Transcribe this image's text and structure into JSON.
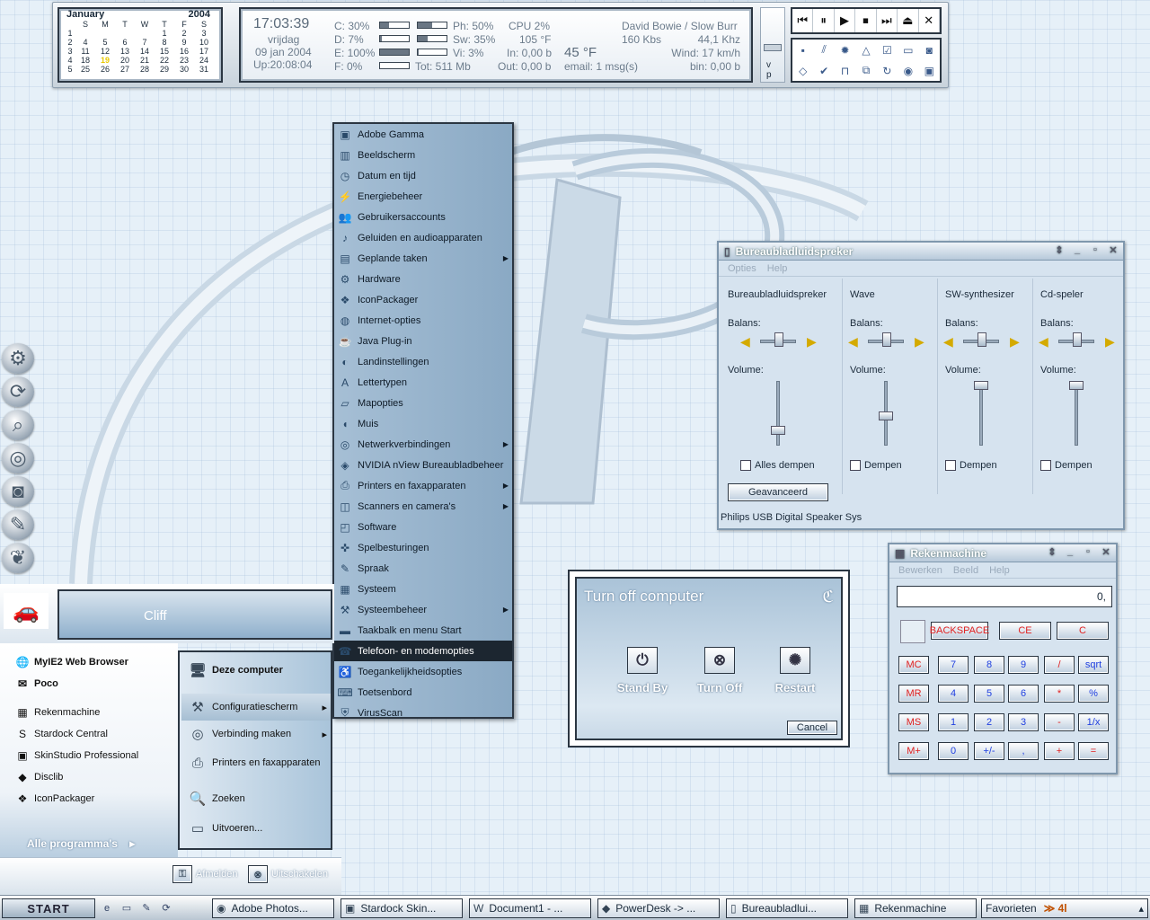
{
  "calendar": {
    "month": "January",
    "year": "2004",
    "weekdays": [
      "S",
      "M",
      "T",
      "W",
      "T",
      "F",
      "S"
    ],
    "weeks": [
      [
        "1",
        "",
        "",
        "",
        "",
        "1",
        "2",
        "3"
      ],
      [
        "2",
        "4",
        "5",
        "6",
        "7",
        "8",
        "9",
        "10"
      ],
      [
        "3",
        "11",
        "12",
        "13",
        "14",
        "15",
        "16",
        "17"
      ],
      [
        "4",
        "18",
        "19",
        "20",
        "21",
        "22",
        "23",
        "24"
      ],
      [
        "5",
        "25",
        "26",
        "27",
        "28",
        "29",
        "30",
        "31"
      ]
    ],
    "today": "19"
  },
  "sysinfo": {
    "time": "17:03:39",
    "day": "vrijdag",
    "date": "09 jan 2004",
    "uptime": "Up:20:08:04",
    "drive_c": "C: 30%",
    "drive_d": "D: 7%",
    "drive_e": "E: 100%",
    "drive_f": "F: 0%",
    "tot": "Tot: 511 Mb",
    "ph": "Ph: 50%",
    "sw": "Sw: 35%",
    "vi": "Vi: 3%",
    "cpu": "CPU 2%",
    "temp_f": "105 °F",
    "in": "In: 0,00 b",
    "out": "Out: 0,00 b",
    "weather": "45 °F",
    "email": "email: 1 msg(s)",
    "track": "David Bowie / Slow Burr",
    "kbps": "160 Kbs",
    "khz": "44,1 Khz",
    "wind": "Wind: 17 km/h",
    "bin": "bin: 0,00 b",
    "bars": {
      "c": 0.3,
      "d": 0.07,
      "e": 1.0,
      "f": 0.0,
      "ph": 0.5,
      "sw": 0.35,
      "vi": 0.03
    },
    "vol_labels": "v p"
  },
  "media": {
    "buttons": [
      "⏮",
      "⏸",
      "▶",
      "⏹",
      "⏭",
      "⏏",
      "✕"
    ],
    "icons": [
      "▪",
      "⫽",
      "✹",
      "△",
      "☑",
      "▭",
      "◙",
      "◇",
      "✔",
      "⊓",
      "⧉",
      "↻",
      "◉",
      "▣"
    ]
  },
  "dock": {
    "icons": [
      "control-panel-icon",
      "sync-icon",
      "search-icon",
      "disc-icon",
      "camera-icon",
      "paint-icon",
      "skin-icon"
    ]
  },
  "start_menu": {
    "user": "Cliff",
    "all_programs": "Alle programma's",
    "pinned": [
      {
        "label": "MyIE2 Web Browser",
        "icon": "🌐"
      },
      {
        "label": "Poco",
        "icon": "✉"
      }
    ],
    "recent": [
      {
        "label": "Rekenmachine",
        "icon": "▦"
      },
      {
        "label": "Stardock Central",
        "icon": "S"
      },
      {
        "label": "SkinStudio Professional",
        "icon": "▣"
      },
      {
        "label": "Disclib",
        "icon": "◆"
      },
      {
        "label": "IconPackager",
        "icon": "❖"
      }
    ],
    "right": [
      {
        "label": "Deze computer",
        "icon": "🖥"
      },
      {
        "label": "Configuratiescherm",
        "icon": "⚒"
      },
      {
        "label": "Verbinding maken",
        "icon": "◎"
      },
      {
        "label": "Printers en faxapparaten",
        "icon": "⎙"
      },
      {
        "label": "Zoeken",
        "icon": "🔍"
      },
      {
        "label": "Uitvoeren...",
        "icon": "▭"
      }
    ],
    "logoff": "Afmelden",
    "shutdown": "Uitschakelen"
  },
  "control_panel": {
    "items": [
      {
        "label": "Adobe Gamma",
        "icon": "▣",
        "arrow": ""
      },
      {
        "label": "Beeldscherm",
        "icon": "▥",
        "arrow": ""
      },
      {
        "label": "Datum en tijd",
        "icon": "◷",
        "arrow": ""
      },
      {
        "label": "Energiebeheer",
        "icon": "⚡",
        "arrow": ""
      },
      {
        "label": "Gebruikersaccounts",
        "icon": "👥",
        "arrow": ""
      },
      {
        "label": "Geluiden en audioapparaten",
        "icon": "♪",
        "arrow": ""
      },
      {
        "label": "Geplande taken",
        "icon": "▤",
        "arrow": "▶"
      },
      {
        "label": "Hardware",
        "icon": "⚙",
        "arrow": ""
      },
      {
        "label": "IconPackager",
        "icon": "❖",
        "arrow": ""
      },
      {
        "label": "Internet-opties",
        "icon": "◍",
        "arrow": ""
      },
      {
        "label": "Java Plug-in",
        "icon": "☕",
        "arrow": ""
      },
      {
        "label": "Landinstellingen",
        "icon": "◐",
        "arrow": ""
      },
      {
        "label": "Lettertypen",
        "icon": "A",
        "arrow": ""
      },
      {
        "label": "Mapopties",
        "icon": "▱",
        "arrow": ""
      },
      {
        "label": "Muis",
        "icon": "◖",
        "arrow": ""
      },
      {
        "label": "Netwerkverbindingen",
        "icon": "◎",
        "arrow": "▶"
      },
      {
        "label": "NVIDIA nView Bureaubladbeheer",
        "icon": "◈",
        "arrow": ""
      },
      {
        "label": "Printers en faxapparaten",
        "icon": "⎙",
        "arrow": "▶"
      },
      {
        "label": "Scanners en camera's",
        "icon": "◫",
        "arrow": "▶"
      },
      {
        "label": "Software",
        "icon": "◰",
        "arrow": ""
      },
      {
        "label": "Spelbesturingen",
        "icon": "✜",
        "arrow": ""
      },
      {
        "label": "Spraak",
        "icon": "✎",
        "arrow": ""
      },
      {
        "label": "Systeem",
        "icon": "▦",
        "arrow": ""
      },
      {
        "label": "Systeembeheer",
        "icon": "⚒",
        "arrow": "▶"
      },
      {
        "label": "Taakbalk en menu Start",
        "icon": "▬",
        "arrow": ""
      },
      {
        "label": "Telefoon- en modemopties",
        "icon": "☎",
        "arrow": ""
      },
      {
        "label": "Toegankelijkheidsopties",
        "icon": "♿",
        "arrow": ""
      },
      {
        "label": "Toetsenbord",
        "icon": "⌨",
        "arrow": ""
      },
      {
        "label": "VirusScan",
        "icon": "⛨",
        "arrow": ""
      }
    ],
    "selected": "Telefoon- en modemopties"
  },
  "mixer": {
    "title": "Bureaubladluidspreker",
    "menu": [
      "Opties",
      "Help"
    ],
    "balans": "Balans:",
    "volume": "Volume:",
    "columns": [
      {
        "name": "Bureaubladluidspreker",
        "check": "Alles dempen",
        "volume": 0.2
      },
      {
        "name": "Wave",
        "check": "Dempen",
        "volume": 0.45
      },
      {
        "name": "SW-synthesizer",
        "check": "Dempen",
        "volume": 1.0
      },
      {
        "name": "Cd-speler",
        "check": "Dempen",
        "volume": 1.0
      }
    ],
    "advanced": "Geavanceerd",
    "status": "Philips USB Digital Speaker Sys"
  },
  "shutdown": {
    "title": "Turn off computer",
    "standby": "Stand By",
    "turnoff": "Turn Off",
    "restart": "Restart",
    "cancel": "Cancel"
  },
  "calculator": {
    "title": "Rekenmachine",
    "menu": [
      "Bewerken",
      "Beeld",
      "Help"
    ],
    "display": "0,",
    "keys": {
      "backspace": "BACKSPACE",
      "ce": "CE",
      "c": "C",
      "memory": [
        "MC",
        "MR",
        "MS",
        "M+"
      ],
      "rows": [
        [
          "7",
          "8",
          "9",
          "/",
          "sqrt"
        ],
        [
          "4",
          "5",
          "6",
          "*",
          "%"
        ],
        [
          "1",
          "2",
          "3",
          "-",
          "1/x"
        ],
        [
          "0",
          "+/-",
          ",",
          "+",
          "="
        ]
      ]
    }
  },
  "taskbar": {
    "start": "START",
    "quicklaunch": [
      "e",
      "▭",
      "✎",
      "⟳"
    ],
    "tasks": [
      {
        "label": "Adobe Photos...",
        "icon": "◉"
      },
      {
        "label": "Stardock Skin...",
        "icon": "▣"
      },
      {
        "label": "Document1 - ...",
        "icon": "W"
      },
      {
        "label": "PowerDesk -> ...",
        "icon": "◆"
      },
      {
        "label": "Bureaubladlui...",
        "icon": "▯"
      },
      {
        "label": "Rekenmachine",
        "icon": "▦"
      }
    ],
    "tray_label": "Favorieten",
    "clock_glyphs": "≫ 4l"
  }
}
